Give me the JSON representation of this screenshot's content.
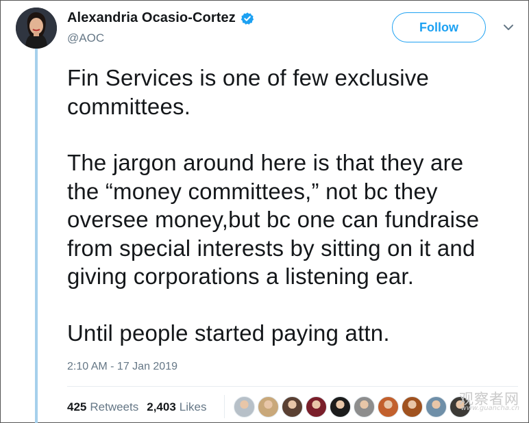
{
  "author": {
    "display_name": "Alexandria Ocasio-Cortez",
    "handle": "@AOC",
    "verified": true
  },
  "follow_label": "Follow",
  "tweet": {
    "paragraphs": [
      "Fin Services is one of few exclusive\ncommittees.",
      "The jargon around here is that they are\nthe “money committees,” not bc they\noversee money,but bc one can fundraise\nfrom special interests by sitting on it and\ngiving corporations a listening ear.",
      "Until people started paying attn."
    ],
    "timestamp": "2:10 AM - 17 Jan 2019"
  },
  "stats": {
    "retweets_count": "425",
    "retweets_label": "Retweets",
    "likes_count": "2,403",
    "likes_label": "Likes"
  },
  "likers": [
    {
      "color": "#b7c0c8"
    },
    {
      "color": "#c9a87a"
    },
    {
      "color": "#5a4032"
    },
    {
      "color": "#7a1f2a"
    },
    {
      "color": "#1c1c1c"
    },
    {
      "color": "#8d8d8d"
    },
    {
      "color": "#c2602d"
    },
    {
      "color": "#a0521f"
    },
    {
      "color": "#6f8fa8"
    },
    {
      "color": "#3c3a36"
    }
  ],
  "watermark": {
    "main": "观察者网",
    "sub": "www.guancha.cn"
  },
  "colors": {
    "accent": "#1da1f2",
    "thread_line": "#a6d0ec",
    "secondary_text": "#657786"
  }
}
